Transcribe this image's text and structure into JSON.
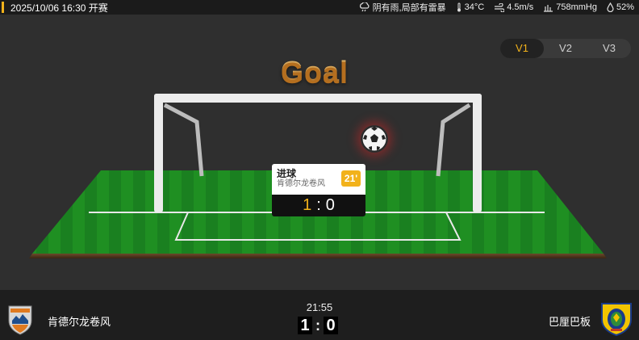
{
  "header": {
    "datetime": "2025/10/06 16:30 开赛",
    "weather": {
      "condition": "阴有雨,局部有雷暴",
      "temperature": "34°C",
      "wind": "4.5m/s",
      "pressure": "758mmHg",
      "humidity": "52%"
    }
  },
  "versions": {
    "tabs": [
      "V1",
      "V2",
      "V3"
    ],
    "active": "V1"
  },
  "animation": {
    "title": "Goal",
    "event": {
      "type": "进球",
      "team": "肯德尔龙卷风",
      "minute": "21'",
      "score_home": "1",
      "score_sep": ":",
      "score_away": "0"
    }
  },
  "match": {
    "home_team": "肯德尔龙卷风",
    "away_team": "巴厘巴板",
    "clock": "21:55",
    "home_score": "1",
    "away_score": "0",
    "score_sep": ":"
  },
  "colors": {
    "accent": "#f2b21b",
    "pitch": "#1f8a1f",
    "background": "#2f2f2f"
  },
  "icons": [
    "cloud-rain-icon",
    "thermometer-icon",
    "wind-icon",
    "pressure-icon",
    "humidity-icon",
    "soccer-ball-icon",
    "home-team-logo",
    "away-team-logo"
  ]
}
